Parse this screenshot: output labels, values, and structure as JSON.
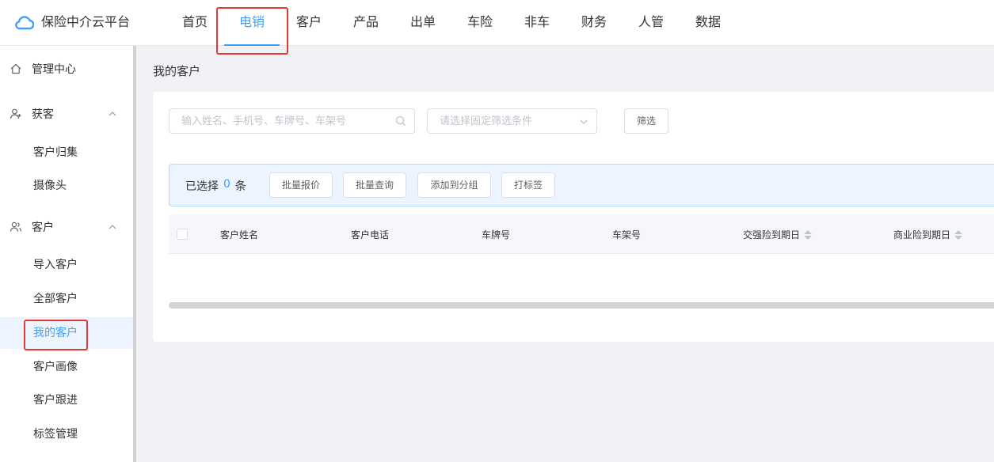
{
  "app": {
    "title": "保险中介云平台"
  },
  "nav": {
    "items": [
      {
        "label": "首页"
      },
      {
        "label": "电销"
      },
      {
        "label": "客户"
      },
      {
        "label": "产品"
      },
      {
        "label": "出单"
      },
      {
        "label": "车险"
      },
      {
        "label": "非车"
      },
      {
        "label": "财务"
      },
      {
        "label": "人管"
      },
      {
        "label": "数据"
      }
    ],
    "active_color": "#409eff"
  },
  "sidebar": {
    "groups": [
      {
        "label": "管理中心",
        "icon": "home-icon"
      },
      {
        "label": "获客",
        "icon": "user-add-icon"
      },
      {
        "label": "客户",
        "icon": "users-icon"
      }
    ],
    "items": [
      {
        "label": "客户归集"
      },
      {
        "label": "摄像头"
      },
      {
        "label": "导入客户"
      },
      {
        "label": "全部客户"
      },
      {
        "label": "我的客户"
      },
      {
        "label": "客户画像"
      },
      {
        "label": "客户跟进"
      },
      {
        "label": "标签管理"
      }
    ]
  },
  "main": {
    "title": "我的客户",
    "search": {
      "placeholder": "输入姓名、手机号、车牌号、车架号",
      "value": ""
    },
    "filter_select": {
      "placeholder": "请选择固定筛选条件",
      "value": ""
    },
    "filter_button": "筛选",
    "selection": {
      "prefix": "已选择",
      "count": "0",
      "suffix": "条"
    },
    "batch_buttons": [
      "批量报价",
      "批量查询",
      "添加到分组",
      "打标签"
    ],
    "table": {
      "columns": [
        "客户姓名",
        "客户电话",
        "车牌号",
        "车架号",
        "交强险到期日",
        "商业险到期日"
      ],
      "rows": []
    }
  },
  "colors": {
    "accent": "#409eff",
    "highlight": "#e53935"
  }
}
